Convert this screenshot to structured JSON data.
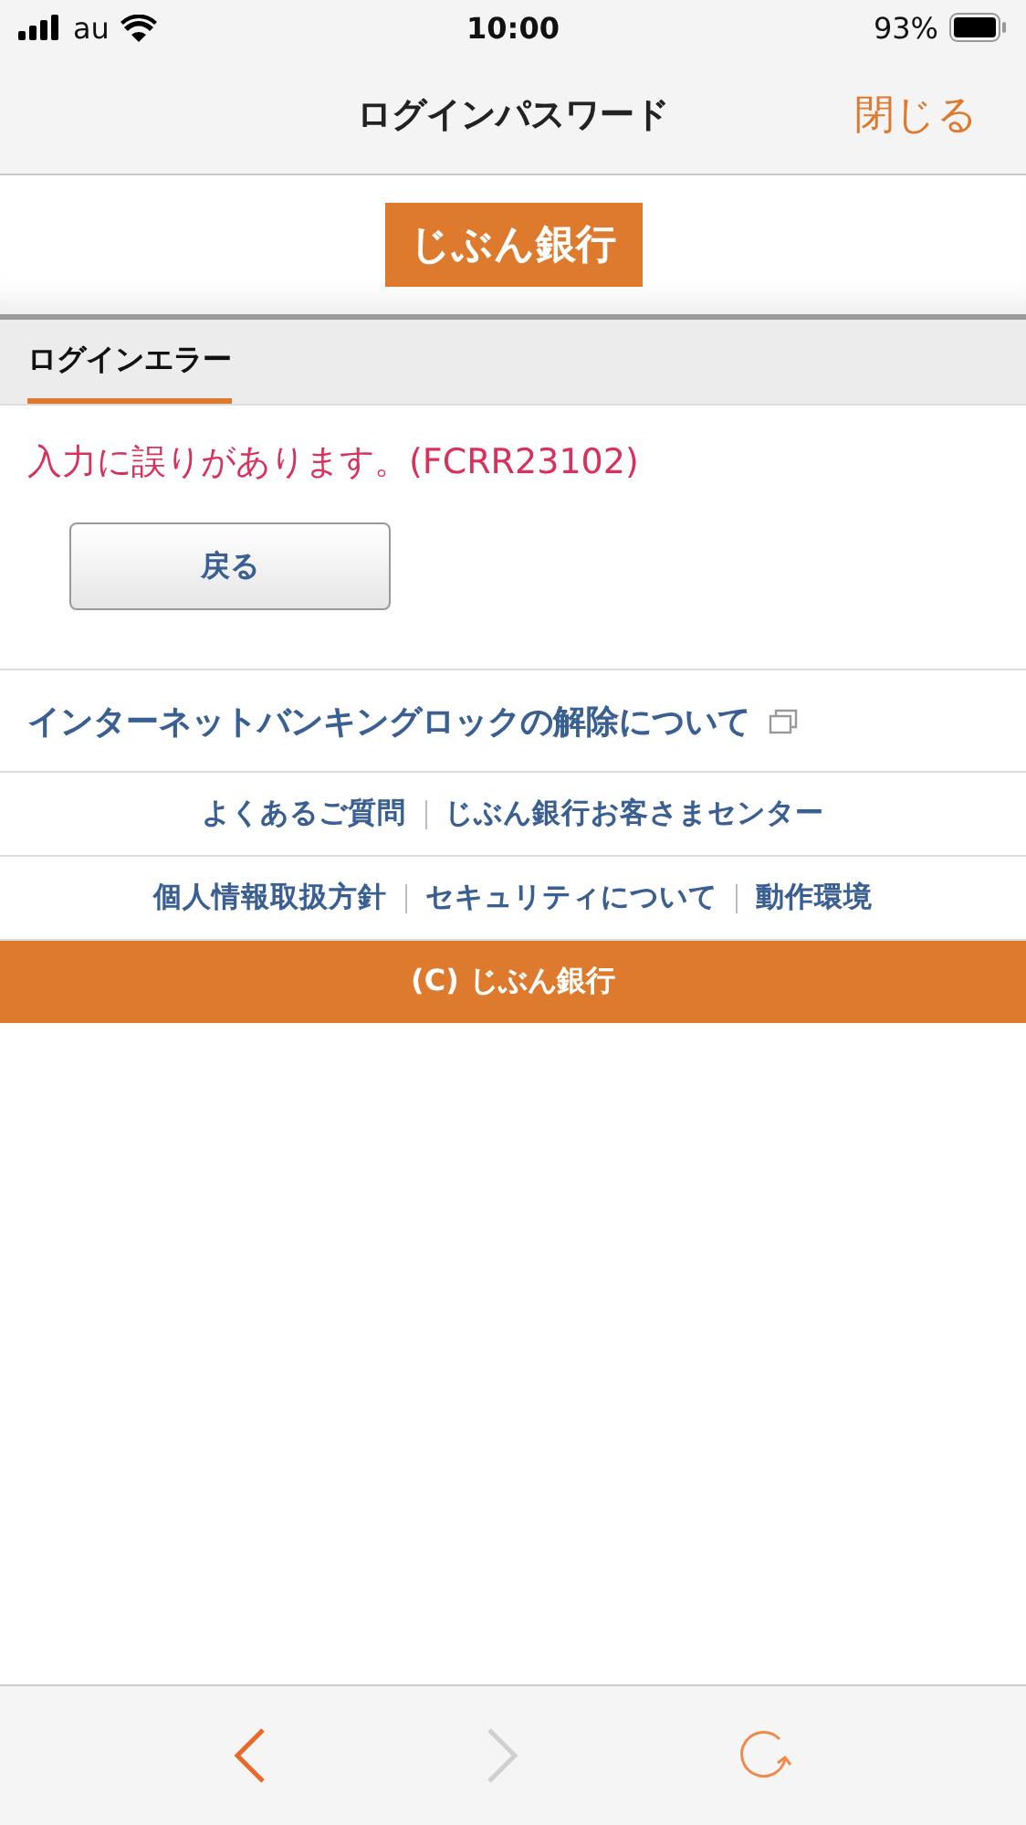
{
  "status_bar": {
    "carrier": "au",
    "time": "10:00",
    "battery": "93%"
  },
  "nav_bar": {
    "title": "ログインパスワード",
    "close": "閉じる"
  },
  "logo": "じぶん銀行",
  "tabs": [
    {
      "label": "ログインエラー",
      "selected": true
    }
  ],
  "error_message": "入力に誤りがあります。(FCRR23102)",
  "back_button": "戻る",
  "lock_link": "インターネットバンキングロックの解除について",
  "footer_links": [
    [
      "よくあるご質問",
      "じぶん銀行お客さまセンター"
    ],
    [
      "個人情報取扱方針",
      "セキュリティについて",
      "動作環境"
    ]
  ],
  "copyright": "(C) じぶん銀行",
  "toolbar": [
    {
      "kind": "back",
      "disabled": false
    },
    {
      "kind": "forward",
      "disabled": true
    },
    {
      "kind": "reload",
      "disabled": false
    }
  ]
}
